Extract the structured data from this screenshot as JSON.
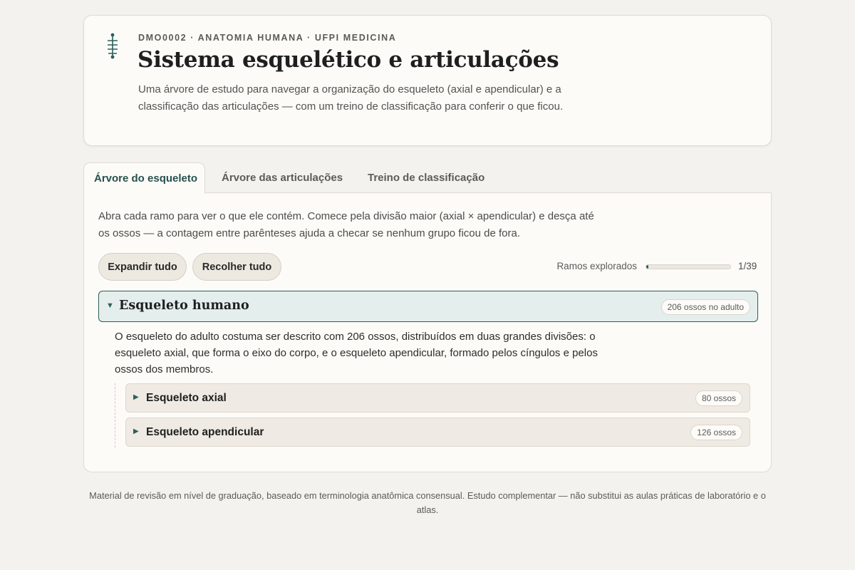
{
  "header": {
    "kicker": "DMO0002 · ANATOMIA HUMANA · UFPI MEDICINA",
    "title": "Sistema esquelético e articulações",
    "subtitle": "Uma árvore de estudo para navegar a organização do esqueleto (axial e apendicular) e a classificação das articulações — com um treino de classificação para conferir o que ficou.",
    "logo_icon": "spine-icon",
    "accent": "#2c5f5a"
  },
  "tabs": [
    {
      "label": "Árvore do esqueleto",
      "active": true
    },
    {
      "label": "Árvore das articulações",
      "active": false
    },
    {
      "label": "Treino de classificação",
      "active": false
    }
  ],
  "panel": {
    "intro": "Abra cada ramo para ver o que ele contém. Comece pela divisão maior (axial × apendicular) e desça até os ossos — a contagem entre parênteses ajuda a checar se nenhum grupo ficou de fora.",
    "expand_label": "Expandir tudo",
    "collapse_label": "Recolher tudo",
    "progress": {
      "label": "Ramos explorados",
      "explored": 1,
      "total": 39,
      "count_text": "1/39"
    }
  },
  "tree": {
    "root": {
      "title": "Esqueleto humano",
      "badge": "206 ossos no adulto",
      "expanded": true,
      "description": "O esqueleto do adulto costuma ser descrito com 206 ossos, distribuídos em duas grandes divisões: o esqueleto axial, que forma o eixo do corpo, e o esqueleto apendicular, formado pelos cíngulos e pelos ossos dos membros.",
      "children": [
        {
          "title": "Esqueleto axial",
          "badge": "80 ossos",
          "expanded": false
        },
        {
          "title": "Esqueleto apendicular",
          "badge": "126 ossos",
          "expanded": false
        }
      ]
    }
  },
  "footer": "Material de revisão em nível de graduação, baseado em terminologia anatômica consensual. Estudo complementar — não substitui as aulas práticas de laboratório e o atlas."
}
